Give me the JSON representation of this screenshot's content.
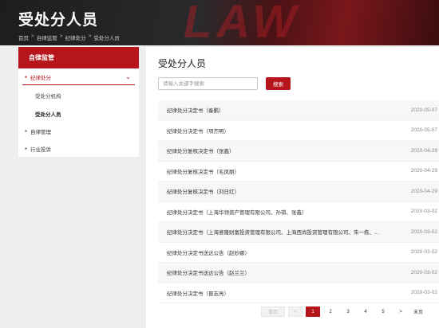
{
  "banner": {
    "title": "受处分人员",
    "deco": "LAW"
  },
  "breadcrumb": [
    "首页",
    "自律监管",
    "纪律处分",
    "受处分人员"
  ],
  "sidebar": {
    "header": "自律监管",
    "items": [
      {
        "label": "纪律处分",
        "active": true
      },
      {
        "label": "受处分机构"
      },
      {
        "label": "受处分人员",
        "current": true
      },
      {
        "label": "自律管理"
      },
      {
        "label": "行业投诉"
      }
    ]
  },
  "main": {
    "title": "受处分人员",
    "search": {
      "placeholder": "请输入关键字搜索",
      "button": "搜索"
    },
    "rows": [
      {
        "title": "纪律处分决定书（秦鹏）",
        "date": "2020-05-07"
      },
      {
        "title": "纪律处分决定书（项杰明）",
        "date": "2020-05-07"
      },
      {
        "title": "纪律处分复核决定书（张鑫）",
        "date": "2020-04-29"
      },
      {
        "title": "纪律处分复核决定书（毛凤丽）",
        "date": "2020-04-29"
      },
      {
        "title": "纪律处分复核决定书（刘日红）",
        "date": "2020-04-29"
      },
      {
        "title": "纪律处分决定书（上海华领资产管理有限公司、孙祺、张鑫）",
        "date": "2020-03-02"
      },
      {
        "title": "纪律处分决定书（上海意隆财富投资管理有限公司、上海西尚投资管理有限公司、朱一栋、...",
        "date": "2020-03-02"
      },
      {
        "title": "纪律处分决定书送达公告（赵妙娜）",
        "date": "2020-03-02"
      },
      {
        "title": "纪律处分决定书送达公告（赵兰兰）",
        "date": "2020-03-02"
      },
      {
        "title": "纪律处分决定书（晋志亮）",
        "date": "2020-03-02"
      }
    ],
    "pager": {
      "first": "首页",
      "prev": "<",
      "pages": [
        "1",
        "2",
        "3",
        "4",
        "5"
      ],
      "next": ">",
      "last": "末页"
    }
  }
}
